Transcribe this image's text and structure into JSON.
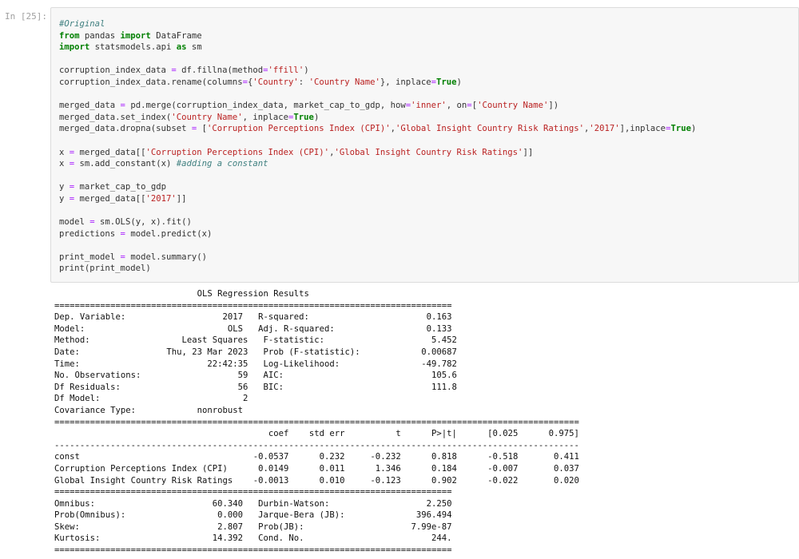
{
  "cell": {
    "prompt": "In [25]:",
    "code_lines": [
      [
        {
          "t": "#Original",
          "c": "cm"
        }
      ],
      [
        {
          "t": "from",
          "c": "kw"
        },
        {
          "t": " pandas "
        },
        {
          "t": "import",
          "c": "kw"
        },
        {
          "t": " DataFrame"
        }
      ],
      [
        {
          "t": "import",
          "c": "kw"
        },
        {
          "t": " statsmodels.api "
        },
        {
          "t": "as",
          "c": "kw"
        },
        {
          "t": " sm"
        }
      ],
      [],
      [
        {
          "t": "corruption_index_data "
        },
        {
          "t": "=",
          "c": "op"
        },
        {
          "t": " df.fillna(method"
        },
        {
          "t": "=",
          "c": "op"
        },
        {
          "t": "'ffill'",
          "c": "st"
        },
        {
          "t": ")"
        }
      ],
      [
        {
          "t": "corruption_index_data.rename(columns"
        },
        {
          "t": "=",
          "c": "op"
        },
        {
          "t": "{"
        },
        {
          "t": "'Country'",
          "c": "st"
        },
        {
          "t": ": "
        },
        {
          "t": "'Country Name'",
          "c": "st"
        },
        {
          "t": "}, inplace"
        },
        {
          "t": "=",
          "c": "op"
        },
        {
          "t": "True",
          "c": "kw"
        },
        {
          "t": ")"
        }
      ],
      [],
      [
        {
          "t": "merged_data "
        },
        {
          "t": "=",
          "c": "op"
        },
        {
          "t": " pd.merge(corruption_index_data, market_cap_to_gdp, how"
        },
        {
          "t": "=",
          "c": "op"
        },
        {
          "t": "'inner'",
          "c": "st"
        },
        {
          "t": ", on"
        },
        {
          "t": "=",
          "c": "op"
        },
        {
          "t": "["
        },
        {
          "t": "'Country Name'",
          "c": "st"
        },
        {
          "t": "])"
        }
      ],
      [
        {
          "t": "merged_data.set_index("
        },
        {
          "t": "'Country Name'",
          "c": "st"
        },
        {
          "t": ", inplace"
        },
        {
          "t": "=",
          "c": "op"
        },
        {
          "t": "True",
          "c": "kw"
        },
        {
          "t": ")"
        }
      ],
      [
        {
          "t": "merged_data.dropna(subset "
        },
        {
          "t": "=",
          "c": "op"
        },
        {
          "t": " ["
        },
        {
          "t": "'Corruption Perceptions Index (CPI)'",
          "c": "st"
        },
        {
          "t": ","
        },
        {
          "t": "'Global Insight Country Risk Ratings'",
          "c": "st"
        },
        {
          "t": ","
        },
        {
          "t": "'2017'",
          "c": "st"
        },
        {
          "t": "],inplace"
        },
        {
          "t": "=",
          "c": "op"
        },
        {
          "t": "True",
          "c": "kw"
        },
        {
          "t": ")"
        }
      ],
      [],
      [
        {
          "t": "x "
        },
        {
          "t": "=",
          "c": "op"
        },
        {
          "t": " merged_data[["
        },
        {
          "t": "'Corruption Perceptions Index (CPI)'",
          "c": "st"
        },
        {
          "t": ","
        },
        {
          "t": "'Global Insight Country Risk Ratings'",
          "c": "st"
        },
        {
          "t": "]]"
        }
      ],
      [
        {
          "t": "x "
        },
        {
          "t": "=",
          "c": "op"
        },
        {
          "t": " sm.add_constant(x) "
        },
        {
          "t": "#adding a constant",
          "c": "cm"
        }
      ],
      [],
      [
        {
          "t": "y "
        },
        {
          "t": "=",
          "c": "op"
        },
        {
          "t": " market_cap_to_gdp"
        }
      ],
      [
        {
          "t": "y "
        },
        {
          "t": "=",
          "c": "op"
        },
        {
          "t": " merged_data[["
        },
        {
          "t": "'2017'",
          "c": "st"
        },
        {
          "t": "]]"
        }
      ],
      [],
      [
        {
          "t": "model "
        },
        {
          "t": "=",
          "c": "op"
        },
        {
          "t": " sm.OLS(y, x).fit()"
        }
      ],
      [
        {
          "t": "predictions "
        },
        {
          "t": "=",
          "c": "op"
        },
        {
          "t": " model.predict(x)"
        }
      ],
      [],
      [
        {
          "t": "print_model "
        },
        {
          "t": "=",
          "c": "op"
        },
        {
          "t": " model.summary()"
        }
      ],
      [
        {
          "t": "print(print_model)"
        }
      ]
    ]
  },
  "output": {
    "lines": [
      "                            OLS Regression Results                            ",
      "==============================================================================",
      "Dep. Variable:                   2017   R-squared:                       0.163",
      "Model:                            OLS   Adj. R-squared:                  0.133",
      "Method:                  Least Squares   F-statistic:                     5.452",
      "Date:                 Thu, 23 Mar 2023   Prob (F-statistic):            0.00687",
      "Time:                         22:42:35   Log-Likelihood:                -49.782",
      "No. Observations:                   59   AIC:                             105.6",
      "Df Residuals:                       56   BIC:                             111.8",
      "Df Model:                            2                                         ",
      "Covariance Type:            nonrobust                                         ",
      "=======================================================================================================",
      "                                          coef    std err          t      P>|t|      [0.025      0.975]",
      "-------------------------------------------------------------------------------------------------------",
      "const                                  -0.0537      0.232     -0.232      0.818      -0.518       0.411",
      "Corruption Perceptions Index (CPI)      0.0149      0.011      1.346      0.184      -0.007       0.037",
      "Global Insight Country Risk Ratings    -0.0013      0.010     -0.123      0.902      -0.022       0.020",
      "==============================================================================",
      "Omnibus:                       60.340   Durbin-Watson:                   2.250",
      "Prob(Omnibus):                  0.000   Jarque-Bera (JB):              396.494",
      "Skew:                           2.807   Prob(JB):                     7.99e-87",
      "Kurtosis:                      14.392   Cond. No.                         244.",
      "=============================================================================="
    ]
  }
}
